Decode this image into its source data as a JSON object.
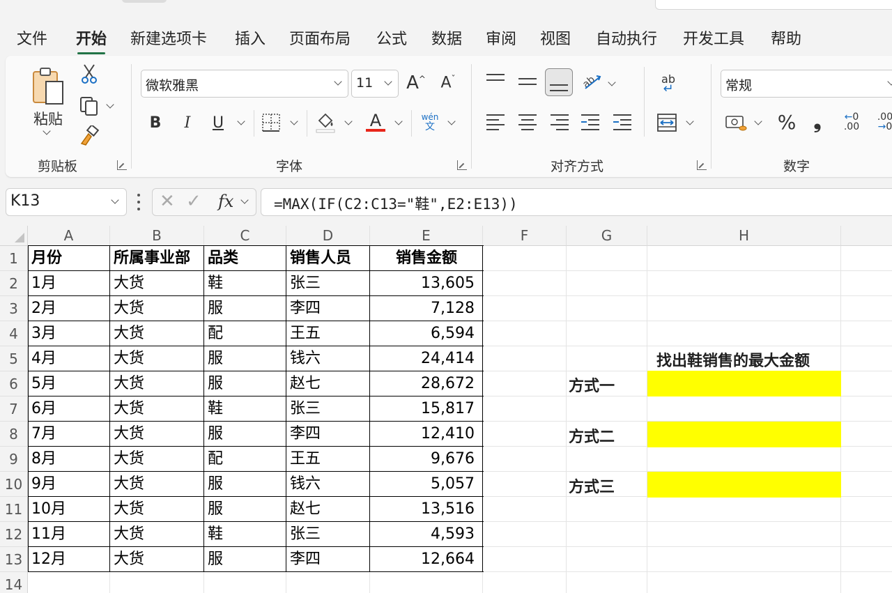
{
  "menu_tabs": [
    "文件",
    "开始",
    "新建选项卡",
    "插入",
    "页面布局",
    "公式",
    "数据",
    "审阅",
    "视图",
    "自动执行",
    "开发工具",
    "帮助"
  ],
  "ribbon": {
    "clipboard": {
      "paste_label": "粘贴",
      "group_label": "剪贴板"
    },
    "font": {
      "font_name": "微软雅黑",
      "font_size": "11",
      "group_label": "字体",
      "phonetic_top": "wén",
      "phonetic_bottom": "文"
    },
    "alignment": {
      "group_label": "对齐方式",
      "wrap_text": "ab"
    },
    "number": {
      "format": "常规",
      "group_label": "数字",
      "percent": "%",
      "comma": "❟",
      "inc_decimal": ".00",
      "dec_decimal": ".00"
    }
  },
  "formula_bar": {
    "name_box": "K13",
    "formula": "=MAX(IF(C2:C13=\"鞋\",E2:E13))"
  },
  "columns": [
    "A",
    "B",
    "C",
    "D",
    "E",
    "F",
    "G",
    "H"
  ],
  "rows": [
    "1",
    "2",
    "3",
    "4",
    "5",
    "6",
    "7",
    "8",
    "9",
    "10",
    "11",
    "12",
    "13",
    "14"
  ],
  "table": {
    "headers": [
      "月份",
      "所属事业部",
      "品类",
      "销售人员",
      "销售金额"
    ],
    "rows": [
      [
        "1月",
        "大货",
        "鞋",
        "张三",
        "13,605"
      ],
      [
        "2月",
        "大货",
        "服",
        "李四",
        "7,128"
      ],
      [
        "3月",
        "大货",
        "配",
        "王五",
        "6,594"
      ],
      [
        "4月",
        "大货",
        "服",
        "钱六",
        "24,414"
      ],
      [
        "5月",
        "大货",
        "服",
        "赵七",
        "28,672"
      ],
      [
        "6月",
        "大货",
        "鞋",
        "张三",
        "15,817"
      ],
      [
        "7月",
        "大货",
        "服",
        "李四",
        "12,410"
      ],
      [
        "8月",
        "大货",
        "配",
        "王五",
        "9,676"
      ],
      [
        "9月",
        "大货",
        "服",
        "钱六",
        "5,057"
      ],
      [
        "10月",
        "大货",
        "服",
        "赵七",
        "13,516"
      ],
      [
        "11月",
        "大货",
        "鞋",
        "张三",
        "4,593"
      ],
      [
        "12月",
        "大货",
        "服",
        "李四",
        "12,664"
      ]
    ]
  },
  "side_panel": {
    "title": "找出鞋销售的最大金额",
    "methods": [
      "方式一",
      "方式二",
      "方式三"
    ],
    "highlight_color": "#ffff00"
  },
  "colors": {
    "accent": "#217346",
    "font_color_bar": "#e8261a"
  }
}
